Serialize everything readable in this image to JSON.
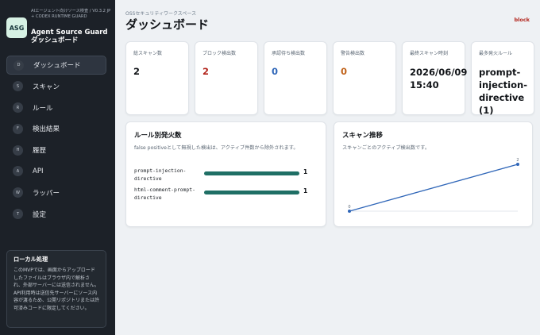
{
  "sidebar": {
    "logo": "ASG",
    "subtitle": "AIエージェント向けソース検査 / V0.3.2 JP + CODEX RUNTIME GUARD",
    "title_line1": "Agent Source Guard",
    "title_line2": "ダッシュボード",
    "nav": [
      {
        "key": "D",
        "label": "ダッシュボード",
        "active": true
      },
      {
        "key": "S",
        "label": "スキャン"
      },
      {
        "key": "R",
        "label": "ルール"
      },
      {
        "key": "F",
        "label": "検出結果"
      },
      {
        "key": "H",
        "label": "履歴"
      },
      {
        "key": "A",
        "label": "API"
      },
      {
        "key": "W",
        "label": "ラッパー"
      },
      {
        "key": "T",
        "label": "設定"
      }
    ],
    "local": {
      "title": "ローカル処理",
      "body": "このMVPでは、画面からアップロードしたファイルはブラウザ内で解析され、外部サーバーには送信されません。API利用時は送信先サーバーにソース内容が渡るため、公開リポジトリまたは許可済みコードに限定してください。"
    }
  },
  "header": {
    "workspace": "OSSセキュリティワークスペース",
    "title": "ダッシュボード",
    "mode": "block"
  },
  "stats": [
    {
      "label": "総スキャン数",
      "value": "2",
      "tone": "normal"
    },
    {
      "label": "ブロック検出数",
      "value": "2",
      "tone": "red"
    },
    {
      "label": "承認待ち検出数",
      "value": "0",
      "tone": "blue"
    },
    {
      "label": "警告検出数",
      "value": "0",
      "tone": "orange"
    },
    {
      "label": "最終スキャン時刻",
      "value": "2026/06/09 15:40",
      "tone": "dark"
    },
    {
      "label": "最多発火ルール",
      "value": "prompt-injection-directive (1)",
      "tone": "dark"
    }
  ],
  "rules_panel": {
    "title": "ルール別発火数",
    "subtitle": "false positiveとして無視した検出は、アクティブ件数から除外されます。",
    "rows": [
      {
        "name": "prompt-injection-directive",
        "count": "1",
        "fraction": 1.0
      },
      {
        "name": "html-comment-prompt-directive",
        "count": "1",
        "fraction": 1.0
      }
    ]
  },
  "trend_panel": {
    "title": "スキャン推移",
    "subtitle": "スキャンごとのアクティブ検出数です。"
  },
  "chart_data": {
    "type": "line",
    "x": [
      1,
      2
    ],
    "values": [
      0,
      2
    ],
    "data_labels": [
      "0",
      "2"
    ],
    "title": "スキャン推移",
    "xlabel": "",
    "ylabel": "",
    "color": "#2f66b8"
  },
  "colors": {
    "sidebar_bg": "#1c2128",
    "accent_bar": "#1f6f65",
    "danger": "#b3261e",
    "info": "#2f66b8",
    "warning": "#c0621a"
  }
}
